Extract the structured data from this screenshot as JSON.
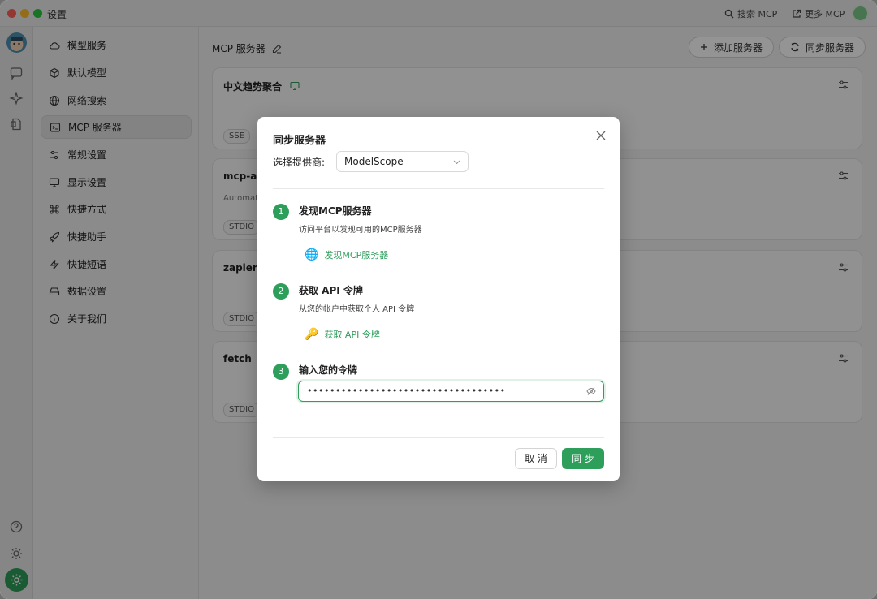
{
  "window": {
    "title": "设置"
  },
  "topbar": {
    "search_mcp": "搜索 MCP",
    "more_mcp": "更多 MCP"
  },
  "sidebar": {
    "items": [
      {
        "label": "模型服务",
        "icon": "cloud-icon"
      },
      {
        "label": "默认模型",
        "icon": "cube-icon"
      },
      {
        "label": "网络搜索",
        "icon": "globe-icon"
      },
      {
        "label": "MCP 服务器",
        "icon": "terminal-icon",
        "active": true
      },
      {
        "label": "常规设置",
        "icon": "sliders-icon"
      },
      {
        "label": "显示设置",
        "icon": "monitor-icon"
      },
      {
        "label": "快捷方式",
        "icon": "command-icon"
      },
      {
        "label": "快捷助手",
        "icon": "rocket-icon"
      },
      {
        "label": "快捷短语",
        "icon": "zap-icon"
      },
      {
        "label": "数据设置",
        "icon": "hard-drive-icon"
      },
      {
        "label": "关于我们",
        "icon": "info-icon"
      }
    ]
  },
  "main": {
    "title": "MCP 服务器",
    "add_button": "添加服务器",
    "sync_button": "同步服务器",
    "servers": [
      {
        "name": "中文趋势聚合",
        "tag": "SSE",
        "desc": ""
      },
      {
        "name": "mcp-au",
        "tag": "STDIO",
        "desc": "Automati"
      },
      {
        "name": "zapier",
        "tag": "STDIO",
        "desc": ""
      },
      {
        "name": "fetch",
        "tag": "STDIO",
        "desc": ""
      }
    ]
  },
  "dialog": {
    "title": "同步服务器",
    "provider_label": "选择提供商:",
    "provider_value": "ModelScope",
    "steps": [
      {
        "num": "1",
        "title": "发现MCP服务器",
        "desc": "访问平台以发现可用的MCP服务器",
        "link": "发现MCP服务器",
        "link_icon": "🌐"
      },
      {
        "num": "2",
        "title": "获取 API 令牌",
        "desc": "从您的帐户中获取个人 API 令牌",
        "link": "获取 API 令牌",
        "link_icon": "🔑"
      },
      {
        "num": "3",
        "title": "输入您的令牌",
        "desc": "",
        "link": "",
        "link_icon": ""
      }
    ],
    "token_value": "•••••••••••••••••••••••••••••••••••",
    "cancel_label": "取 消",
    "sync_label": "同 步"
  },
  "colors": {
    "accent": "#2e9e5b",
    "overlay": "rgba(0,0,0,0.42)"
  }
}
